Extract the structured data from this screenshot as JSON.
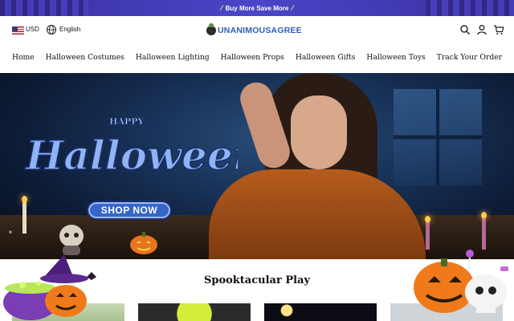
{
  "announcement": {
    "text": "Buy More Save More"
  },
  "topbar": {
    "currency": "USD",
    "language": "English"
  },
  "brand": {
    "name": "UNANIMOUSAGREE"
  },
  "nav": {
    "items": [
      "Home",
      "Halloween Costumes",
      "Halloween Lighting",
      "Halloween Props",
      "Halloween Gifts",
      "Halloween Toys",
      "Track Your Order"
    ]
  },
  "hero": {
    "title_small": "HAPPY",
    "title_large": "Halloween",
    "cta_label": "SHOP NOW",
    "close_label": "×"
  },
  "section": {
    "title": "Spooktacular Play"
  },
  "colors": {
    "announce_bg": "#4b46c8",
    "brand": "#2b5fb5",
    "cta": "#3766c9",
    "hero_bg": "#183258"
  },
  "icons": [
    "us-flag-icon",
    "globe-icon",
    "search-icon",
    "account-icon",
    "cart-icon",
    "wand-icon"
  ]
}
